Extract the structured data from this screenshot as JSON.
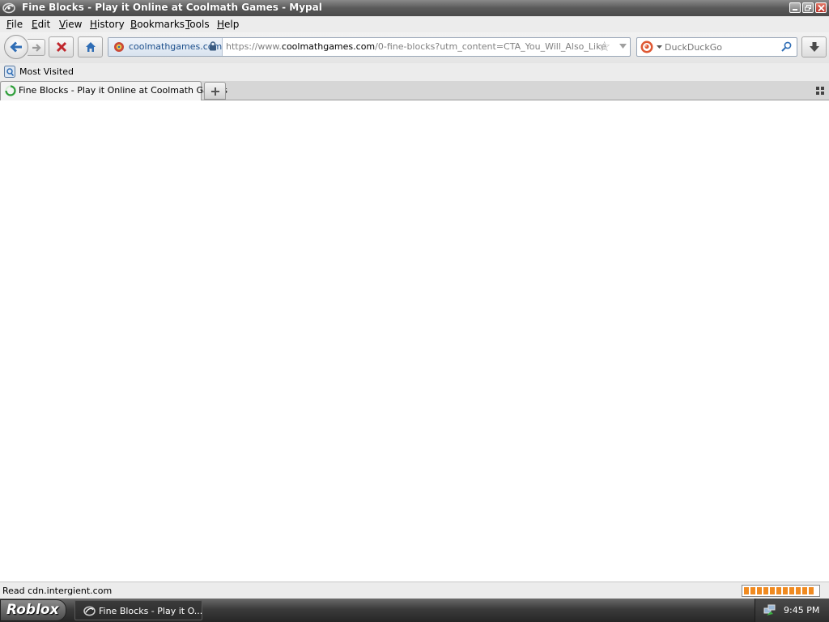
{
  "window": {
    "title": "Fine Blocks - Play it Online at Coolmath Games - Mypal",
    "app_icon": "mypal-icon",
    "controls": [
      "minimize-icon",
      "restore-icon",
      "close-icon"
    ]
  },
  "menubar": {
    "items": [
      {
        "label": "File",
        "mnemonic_index": 0
      },
      {
        "label": "Edit",
        "mnemonic_index": 0
      },
      {
        "label": "View",
        "mnemonic_index": 0
      },
      {
        "label": "History",
        "mnemonic_index": 0
      },
      {
        "label": "Bookmarks",
        "mnemonic_index": 0
      },
      {
        "label": "Tools",
        "mnemonic_index": 0
      },
      {
        "label": "Help",
        "mnemonic_index": 0
      }
    ]
  },
  "navbar": {
    "back_icon": "back-arrow-icon",
    "forward_icon": "forward-arrow-icon",
    "stop_icon": "stop-x-icon",
    "home_icon": "home-icon",
    "identity_site": "coolmathgames.com",
    "url_prefix": "https://www.",
    "url_host": "coolmathgames.com",
    "url_path": "/0-fine-blocks?utm_content=CTA_You_Will_Also_Like",
    "search_placeholder": "DuckDuckGo",
    "download_icon": "download-arrow-icon"
  },
  "bookmarks": {
    "items": [
      {
        "label": "Most Visited",
        "icon": "folder-icon"
      }
    ]
  },
  "tabs": {
    "items": [
      {
        "title": "Fine Blocks - Play it Online at Coolmath Games",
        "loading": true
      }
    ]
  },
  "status": {
    "text": "Read cdn.intergient.com",
    "progress_fraction": 0.95
  },
  "taskbar": {
    "start_label": "Roblox",
    "tasks": [
      {
        "label": "Fine Blocks - Play it O..."
      }
    ],
    "clock": "9:45 PM"
  },
  "colors": {
    "progress_fill": "#f08a20",
    "stop_red": "#c0272d",
    "nav_blue": "#2f6db5"
  }
}
